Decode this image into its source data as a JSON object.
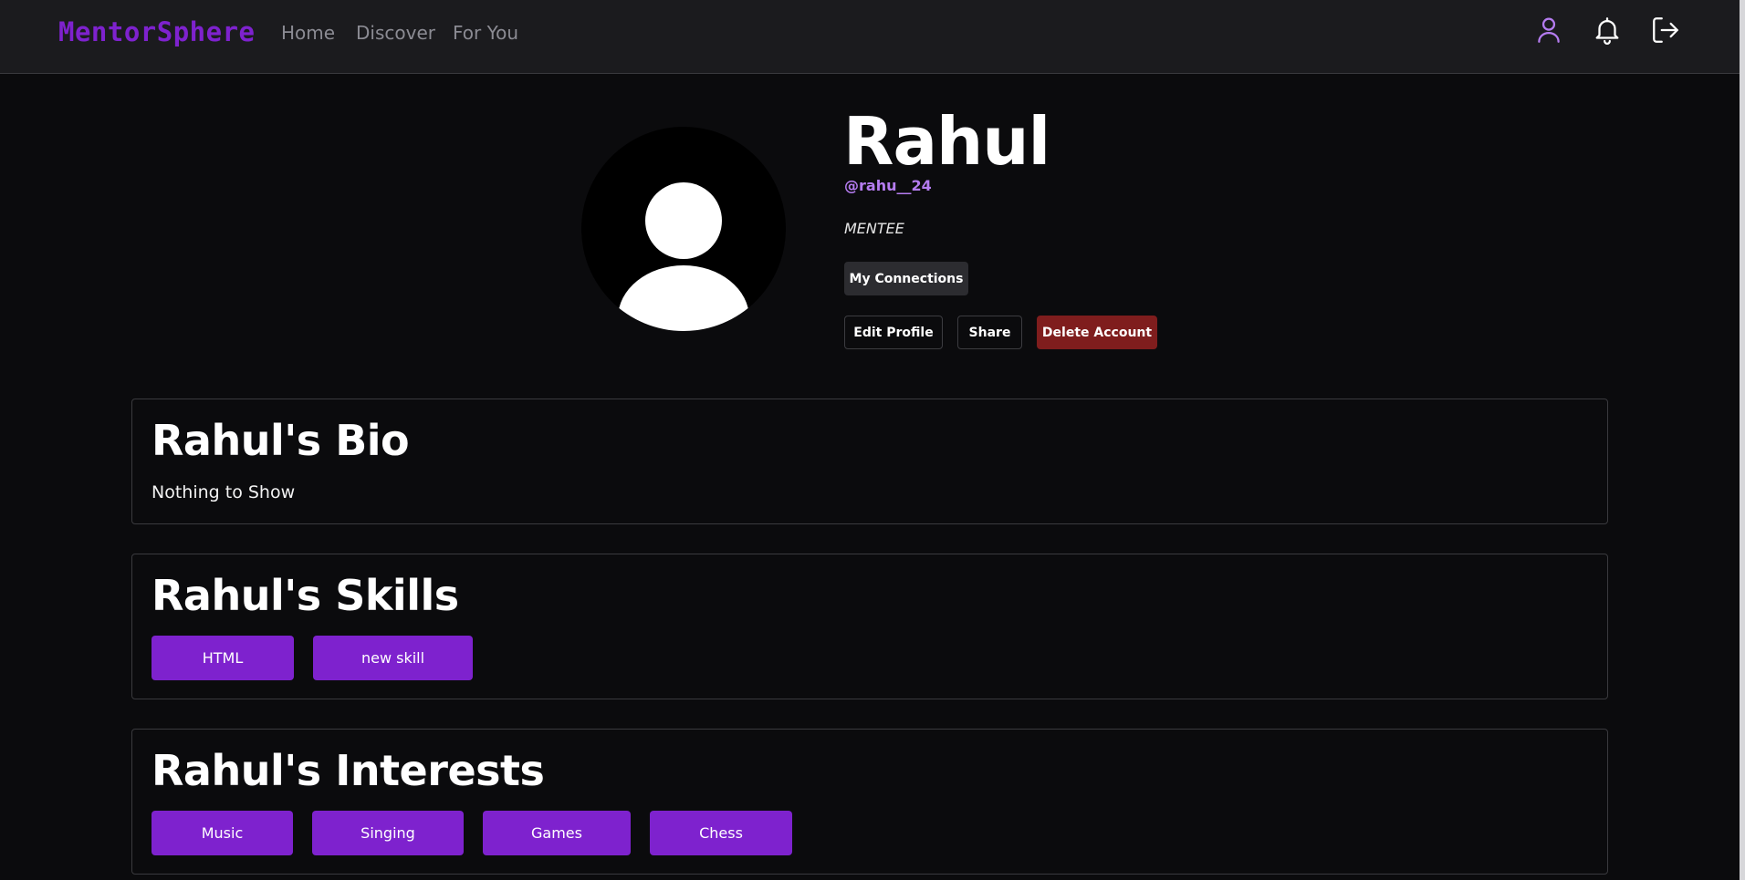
{
  "navbar": {
    "brand": "MentorSphere",
    "links": [
      "Home",
      "Discover",
      "For You"
    ],
    "icons": [
      "user-icon",
      "bell-icon",
      "logout-icon"
    ],
    "accent_color": "#7e22ce"
  },
  "profile": {
    "name": "Rahul",
    "handle": "@rahu__24",
    "role": "MENTEE",
    "avatar_icon": "default-avatar-icon",
    "connections_label": "My Connections",
    "edit_label": "Edit Profile",
    "share_label": "Share",
    "delete_label": "Delete Account",
    "delete_color": "#7f1d1d"
  },
  "bio": {
    "title": "Rahul's Bio",
    "text": "Nothing to Show"
  },
  "skills": {
    "title": "Rahul's Skills",
    "items": [
      "HTML",
      "new skill"
    ]
  },
  "interests": {
    "title": "Rahul's Interests",
    "items": [
      "Music",
      "Singing",
      "Games",
      "Chess"
    ]
  }
}
